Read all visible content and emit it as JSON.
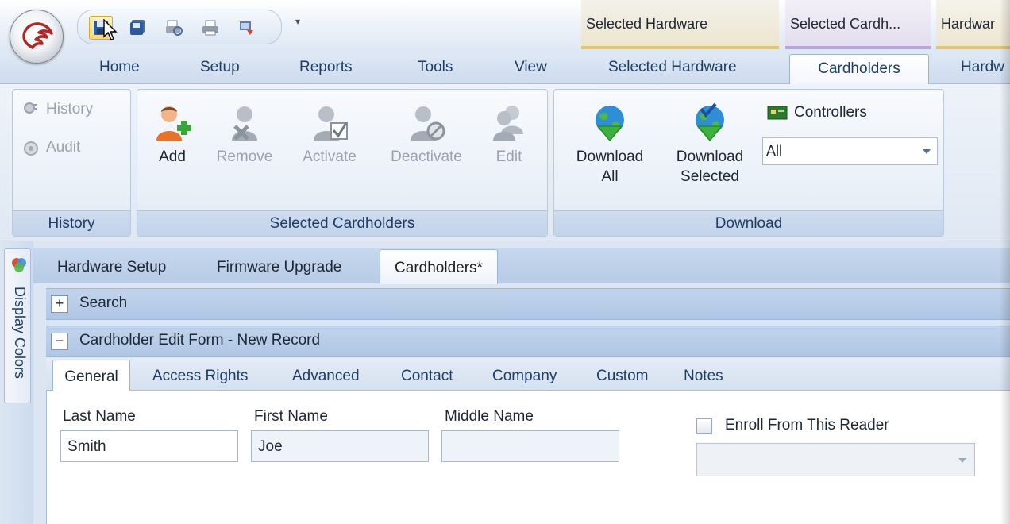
{
  "quick_access": {
    "icons": [
      "save-icon",
      "save-all-icon",
      "print-preview-icon",
      "print-icon",
      "export-icon"
    ],
    "more_glyph": "▾"
  },
  "context_tabs": [
    "Selected Hardware",
    "Selected Cardh...",
    "Hardwar"
  ],
  "ribbon_tabs": [
    "Home",
    "Setup",
    "Reports",
    "Tools",
    "View",
    "Selected Hardware",
    "Cardholders",
    "Hardw"
  ],
  "active_ribbon_tab": "Cardholders",
  "groups": {
    "history": {
      "label": "History",
      "items": [
        "History",
        "Audit"
      ]
    },
    "selected_cardholders": {
      "label": "Selected Cardholders",
      "buttons": [
        "Add",
        "Remove",
        "Activate",
        "Deactivate",
        "Edit"
      ]
    },
    "download": {
      "label": "Download",
      "download_all": [
        "Download",
        "All"
      ],
      "download_selected": [
        "Download",
        "Selected"
      ],
      "controllers_label": "Controllers",
      "controllers_value": "All"
    }
  },
  "sidebar": {
    "label": "Display Colors"
  },
  "document_tabs": [
    "Hardware Setup",
    "Firmware Upgrade",
    "Cardholders*"
  ],
  "sections": {
    "search": {
      "toggle": "+",
      "title": "Search"
    },
    "edit": {
      "toggle": "−",
      "title": "Cardholder Edit Form - New Record"
    }
  },
  "form_tabs": [
    "General",
    "Access Rights",
    "Advanced",
    "Contact",
    "Company",
    "Custom",
    "Notes"
  ],
  "form": {
    "last_name_label": "Last Name",
    "last_name_value": "Smith",
    "first_name_label": "First Name",
    "first_name_value": "Joe",
    "middle_name_label": "Middle Name",
    "middle_name_value": "",
    "enroll_label": "Enroll From This Reader",
    "enroll_checked": false,
    "enroll_reader_value": ""
  },
  "colors": {
    "ribbon_bg": "#dfe8f3",
    "accent_blue": "#1e3d66",
    "context_yellow": "#e6c46d",
    "context_purple": "#b7a6d9",
    "disabled_text": "#9aa3ad"
  }
}
